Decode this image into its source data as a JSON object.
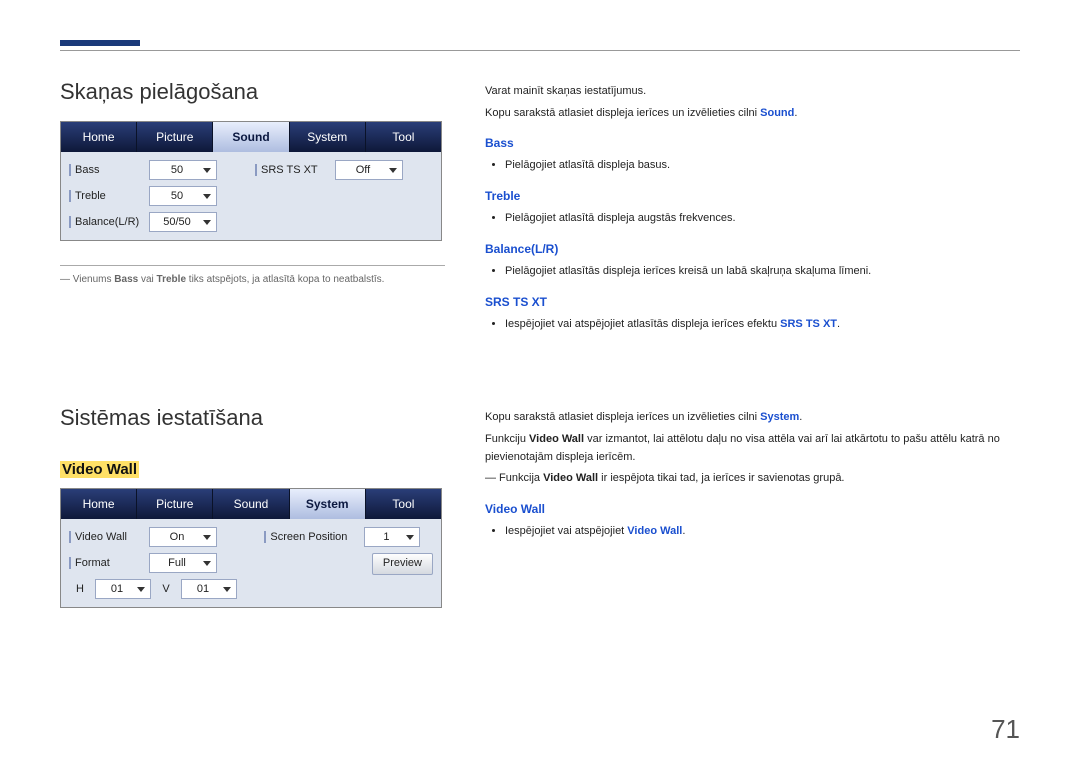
{
  "page_number": "71",
  "section1": {
    "title": "Skaņas pielāgošana",
    "footnote_prefix": "― Vienums ",
    "footnote_b1": "Bass",
    "footnote_mid": " vai ",
    "footnote_b2": "Treble",
    "footnote_suffix": " tiks atspējots, ja atlasītā kopa to neatbalstīs."
  },
  "sound_panel": {
    "tabs": [
      "Home",
      "Picture",
      "Sound",
      "System",
      "Tool"
    ],
    "active_index": 2,
    "left": {
      "bass": {
        "label": "Bass",
        "value": "50"
      },
      "treble": {
        "label": "Treble",
        "value": "50"
      },
      "balance": {
        "label": "Balance(L/R)",
        "value": "50/50"
      }
    },
    "right": {
      "srs": {
        "label": "SRS TS XT",
        "value": "Off"
      }
    }
  },
  "right1": {
    "p1": "Varat mainīt skaņas iestatījumus.",
    "p2a": "Kopu sarakstā atlasiet displeja ierīces un izvēlieties cilni ",
    "p2b": "Sound",
    "p2c": ".",
    "bass": {
      "h": "Bass",
      "li": "Pielāgojiet atlasītā displeja basus."
    },
    "treble": {
      "h": "Treble",
      "li": "Pielāgojiet atlasītā displeja augstās frekvences."
    },
    "balance": {
      "h": "Balance(L/R)",
      "li": "Pielāgojiet atlasītās displeja ierīces kreisā un labā skaļruņa skaļuma līmeni."
    },
    "srs": {
      "h": "SRS TS XT",
      "li_a": "Iespējojiet vai atspējojiet atlasītās displeja ierīces efektu ",
      "li_b": "SRS TS XT",
      "li_c": "."
    }
  },
  "section2": {
    "title": "Sistēmas iestatīšana",
    "sub_hl": "Video Wall"
  },
  "system_panel": {
    "tabs": [
      "Home",
      "Picture",
      "Sound",
      "System",
      "Tool"
    ],
    "active_index": 3,
    "left": {
      "videowall": {
        "label": "Video Wall",
        "value": "On"
      },
      "format": {
        "label": "Format",
        "value": "Full"
      },
      "h": {
        "label": "H",
        "value": "01"
      },
      "v": {
        "label": "V",
        "value": "01"
      }
    },
    "right": {
      "screenpos": {
        "label": "Screen Position",
        "value": "1"
      },
      "preview": "Preview"
    }
  },
  "right2": {
    "p1a": "Kopu sarakstā atlasiet displeja ierīces un izvēlieties cilni ",
    "p1b": "System",
    "p1c": ".",
    "p2a": "Funkciju ",
    "p2b": "Video Wall",
    "p2c": " var izmantot, lai attēlotu daļu no visa attēla vai arī lai atkārtotu to pašu attēlu katrā no pievienotajām displeja ierīcēm.",
    "note_a": "― Funkcija ",
    "note_b": "Video Wall",
    "note_c": " ir iespējota tikai tad, ja ierīces ir savienotas grupā.",
    "vw": {
      "h": "Video Wall",
      "li_a": "Iespējojiet vai atspējojiet ",
      "li_b": "Video Wall",
      "li_c": "."
    }
  }
}
